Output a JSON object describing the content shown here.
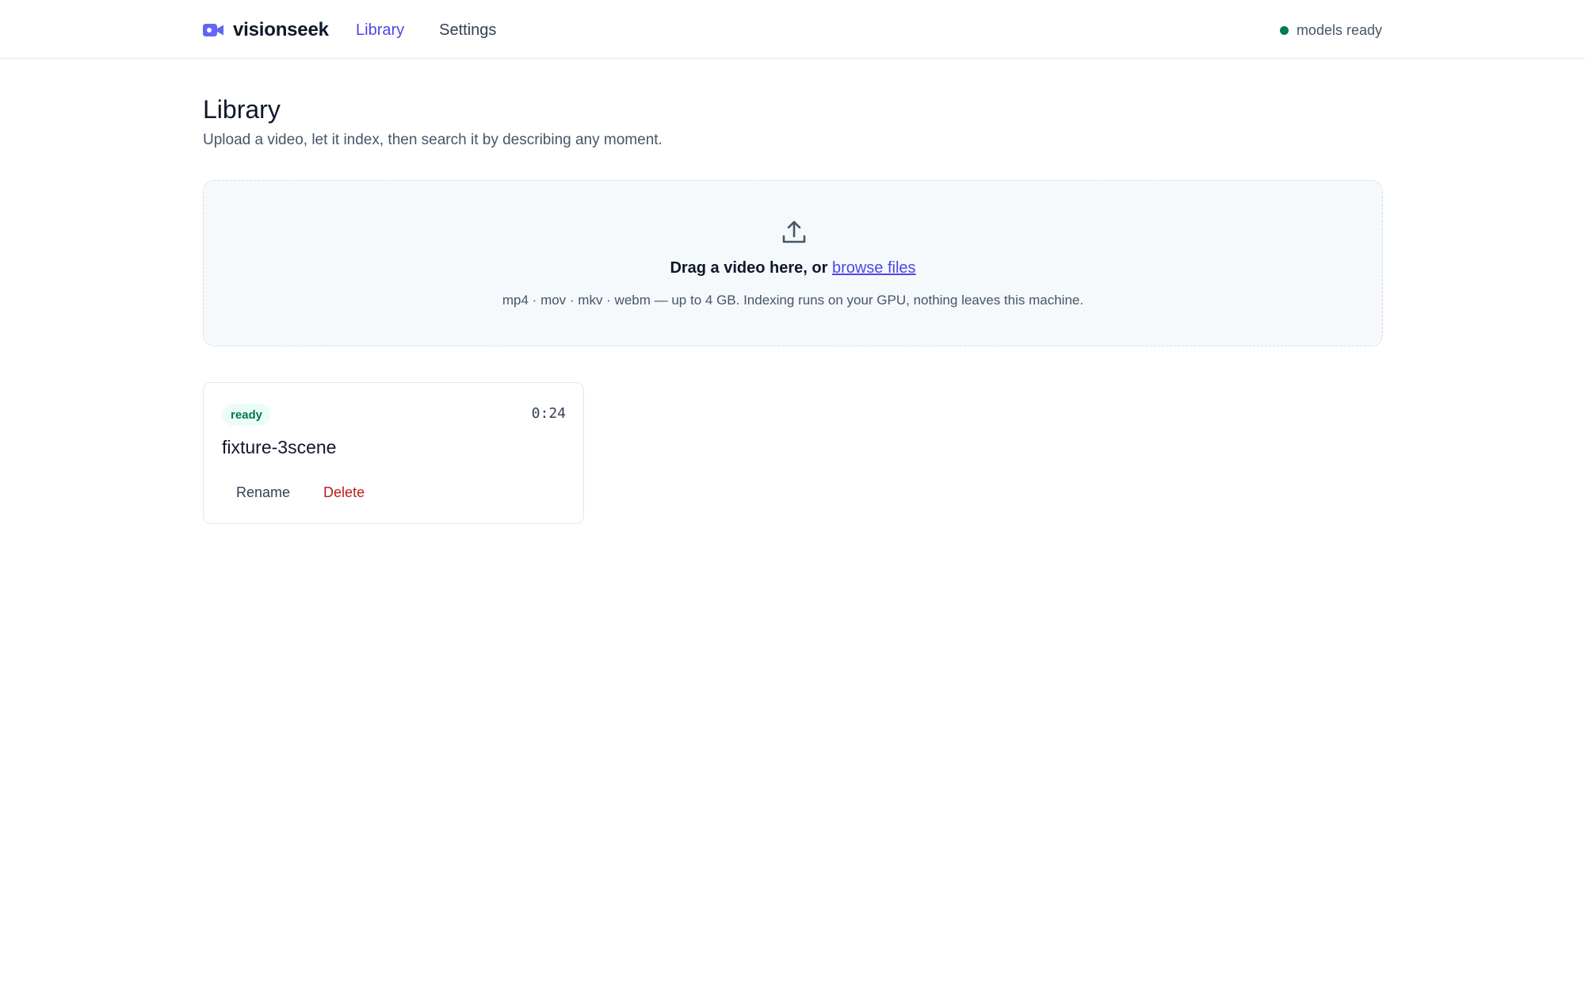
{
  "app": {
    "name": "visionseek",
    "brand_icon": "video-camera-icon",
    "accent_color": "#4f46e5"
  },
  "nav": {
    "items": [
      {
        "label": "Library",
        "active": true
      },
      {
        "label": "Settings",
        "active": false
      }
    ]
  },
  "status": {
    "text": "models ready",
    "color": "#047857"
  },
  "page": {
    "title": "Library",
    "subtitle": "Upload a video, let it index, then search it by describing any moment."
  },
  "dropzone": {
    "icon": "upload-icon",
    "title_prefix": "Drag a video here, or ",
    "link_label": "browse files",
    "hint": "mp4 · mov · mkv · webm — up to 4 GB. Indexing runs on your GPU, nothing leaves this machine."
  },
  "videos": [
    {
      "status": "ready",
      "duration": "0:24",
      "title": "fixture-3scene",
      "actions": {
        "rename": "Rename",
        "delete": "Delete"
      }
    }
  ]
}
